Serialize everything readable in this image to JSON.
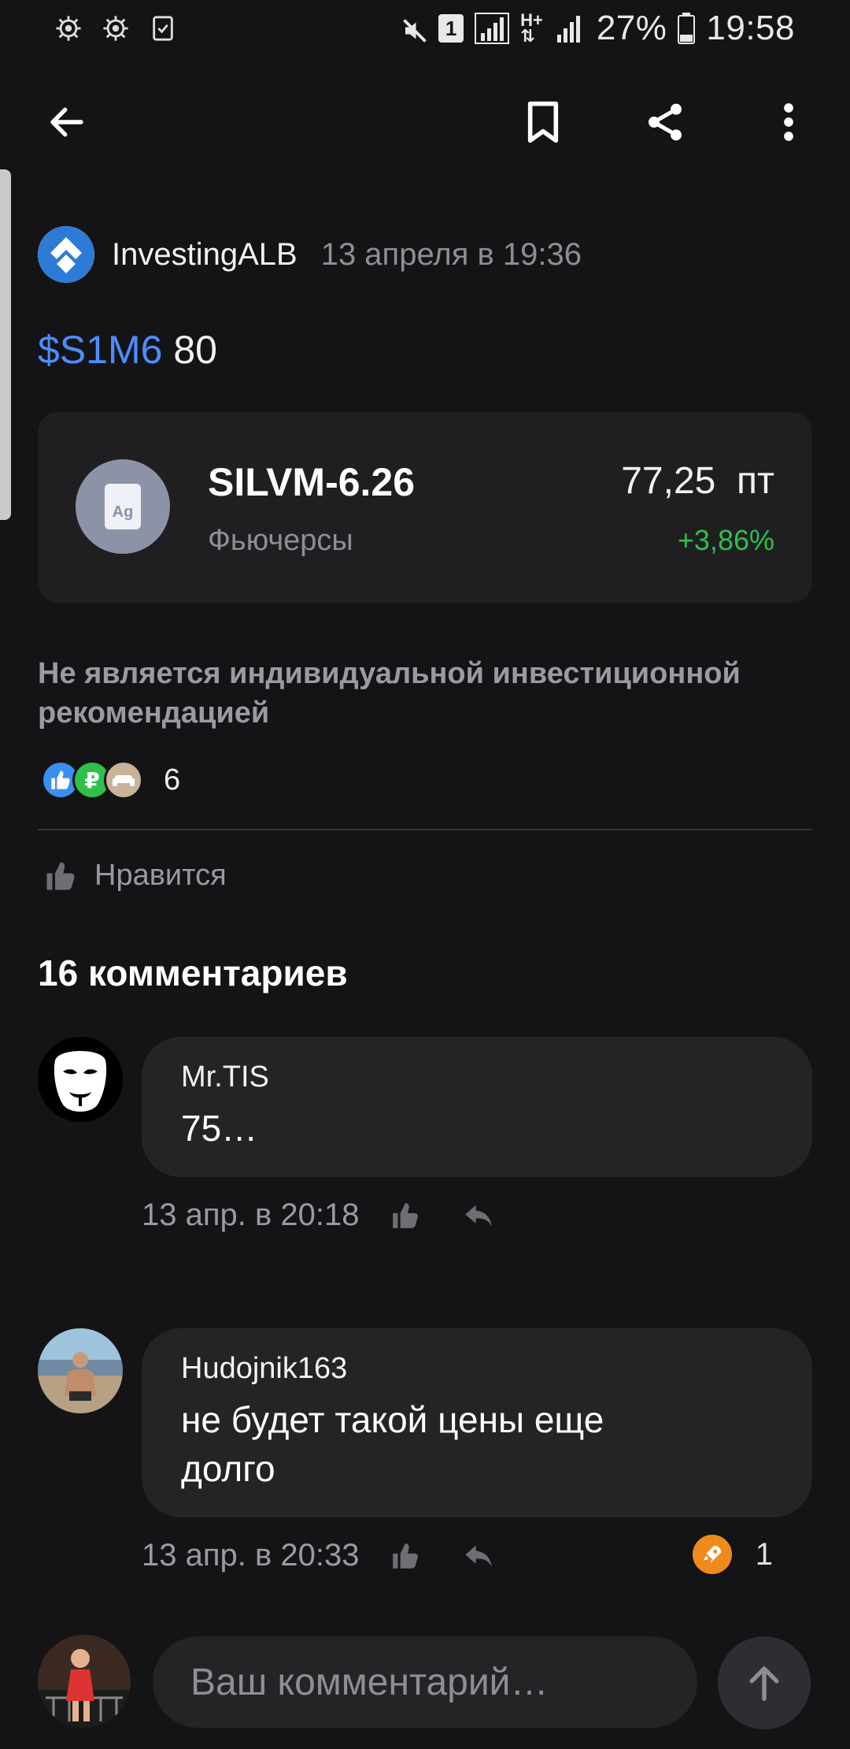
{
  "status_bar": {
    "battery": "27%",
    "time": "19:58",
    "sim_badge": "1",
    "icons": [
      "settings-gear-icon",
      "settings-gear-icon",
      "clipboard-check-icon",
      "mute-icon",
      "sim-icon",
      "signal-icon",
      "hplus-icon",
      "signal-icon",
      "battery-icon"
    ]
  },
  "toolbar": {
    "back_icon": "arrow-left-icon",
    "bookmark_icon": "bookmark-icon",
    "share_icon": "share-icon",
    "more_icon": "more-vertical-icon"
  },
  "post": {
    "author": "InvestingALB",
    "date": "13 апреля в 19:36",
    "ticker": "$S1M6",
    "text": "80",
    "disclaimer": "Не является индивидуальной инвестиционной рекомендацией",
    "reactions_count": "6",
    "like_label": "Нравится"
  },
  "instrument": {
    "name": "SILVM-6.26",
    "type": "Фьючерсы",
    "price": "77,25  пт",
    "change": "+3,86%",
    "icon_label": "Ag",
    "change_color": "#2fbf4a"
  },
  "comments_section": {
    "title": "16 комментариев",
    "comments": [
      {
        "author": "Mr.TIS",
        "text": "75…",
        "time": "13 апр. в 20:18"
      },
      {
        "author": "Hudojnik163",
        "text": "не будет такой цены еще долго",
        "time": "13 апр. в 20:33",
        "score": "1"
      }
    ]
  },
  "composer": {
    "placeholder": "Ваш комментарий…",
    "send_icon": "arrow-up-icon"
  },
  "colors": {
    "background": "#141416",
    "accent_blue": "#4e8cff",
    "positive_green": "#2fbf4a"
  }
}
